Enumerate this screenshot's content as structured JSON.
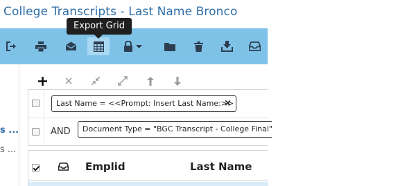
{
  "page": {
    "title": "College Transcripts - Last Name Bronco"
  },
  "colors": {
    "toolbar_bg": "#7fc2e8",
    "title": "#2e6fa8",
    "tooltip_bg": "#1f1f1f"
  },
  "toolbar": {
    "buttons": [
      {
        "name": "exit-icon"
      },
      {
        "name": "print-icon"
      },
      {
        "name": "email-icon"
      },
      {
        "name": "grid-icon",
        "active": true
      },
      {
        "name": "lock-icon"
      },
      {
        "name": "folder-icon"
      },
      {
        "name": "trash-icon"
      },
      {
        "name": "download-icon"
      },
      {
        "name": "inbox-icon"
      }
    ],
    "tooltip": "Export Grid"
  },
  "left_panel": {
    "items": [
      {
        "label": "s ...",
        "selected": true
      },
      {
        "label": "s ...",
        "selected": false
      }
    ]
  },
  "criteria_tools": [
    "add-icon",
    "remove-icon",
    "collapse-icon",
    "expand-icon",
    "arrow-up-icon",
    "arrow-down-icon"
  ],
  "criteria": {
    "rows": [
      {
        "conjunction": "",
        "text": "Last Name = <<Prompt: Insert Last Name:>>",
        "close": "×"
      },
      {
        "conjunction": "AND",
        "text": "Document Type = \"BGC Transcript - College Final\""
      }
    ]
  },
  "grid": {
    "columns": [
      {
        "name": "select",
        "label": ""
      },
      {
        "name": "inbox-icon",
        "label": ""
      },
      {
        "name": "emplid",
        "label": "Emplid"
      },
      {
        "name": "last-name",
        "label": "Last Name"
      }
    ]
  }
}
